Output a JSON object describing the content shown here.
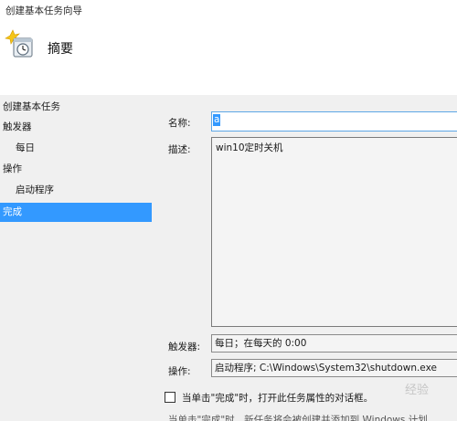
{
  "window": {
    "title": "创建基本任务向导"
  },
  "header": {
    "title": "摘要",
    "icon": "task-scheduler-icon"
  },
  "sidebar": {
    "items": [
      {
        "label": "创建基本任务",
        "level": 0,
        "active": false
      },
      {
        "label": "触发器",
        "level": 0,
        "active": false
      },
      {
        "label": "每日",
        "level": 1,
        "active": false
      },
      {
        "label": "操作",
        "level": 0,
        "active": false
      },
      {
        "label": "启动程序",
        "level": 1,
        "active": false
      },
      {
        "label": "完成",
        "level": 0,
        "active": true
      }
    ]
  },
  "form": {
    "name_label": "名称:",
    "name_value": "a",
    "description_label": "描述:",
    "description_value": "win10定时关机",
    "trigger_label": "触发器:",
    "trigger_value": "每日；在每天的 0:00",
    "action_label": "操作:",
    "action_value": "启动程序; C:\\Windows\\System32\\shutdown.exe"
  },
  "footer": {
    "open_properties_label": "当单击\"完成\"时，打开此任务属性的对话框。",
    "open_properties_checked": false,
    "partial_text": "当单击\"完成\"时，新任务将会被创建并添加到 Windows 计划"
  },
  "watermark": {
    "text": "经验"
  },
  "colors": {
    "selection": "#3399ff",
    "panel_bg": "#f0f0f0"
  }
}
